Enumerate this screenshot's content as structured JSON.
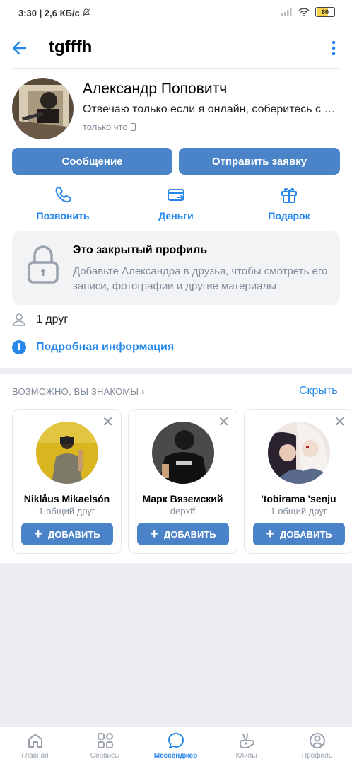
{
  "status_bar": {
    "time": "3:30",
    "speed": "2,6 КБ/с",
    "battery": "60"
  },
  "header": {
    "title": "tgfffh"
  },
  "profile": {
    "name": "Александр Поповитч",
    "status": "Отвечаю только если я онлайн, соберитесь с мыслями",
    "last_seen": "только что",
    "message_button": "Сообщение",
    "request_button": "Отправить заявку",
    "actions": [
      {
        "label": "Позвонить",
        "icon": "phone-icon"
      },
      {
        "label": "Деньги",
        "icon": "money-transfer-icon"
      },
      {
        "label": "Подарок",
        "icon": "gift-icon"
      }
    ],
    "closed_title": "Это закрытый профиль",
    "closed_desc": "Добавьте Александра в друзья, чтобы смотреть его записи, фотографии и другие материалы",
    "friends_count": "1 друг",
    "details_link": "Подробная информация"
  },
  "suggestions": {
    "heading": "ВОЗМОЖНО, ВЫ ЗНАКОМЫ",
    "hide_label": "Скрыть",
    "add_label": "ДОБАВИТЬ",
    "cards": [
      {
        "name": "Niklåus Mikaelsón",
        "sub": "1 общий друг"
      },
      {
        "name": "Марк Вяземский",
        "sub": "depxff"
      },
      {
        "name": "'tobirama 'senju",
        "sub": "1 общий друг"
      }
    ]
  },
  "tabbar": {
    "items": [
      {
        "label": "Главная",
        "icon": "home-icon"
      },
      {
        "label": "Сервисы",
        "icon": "services-icon"
      },
      {
        "label": "Мессенджер",
        "icon": "messenger-icon",
        "active": true
      },
      {
        "label": "Клипы",
        "icon": "clips-icon"
      },
      {
        "label": "Профиль",
        "icon": "profile-icon"
      }
    ]
  },
  "colors": {
    "accent": "#2688eb",
    "button": "#4b83c8",
    "muted": "#818c99"
  }
}
